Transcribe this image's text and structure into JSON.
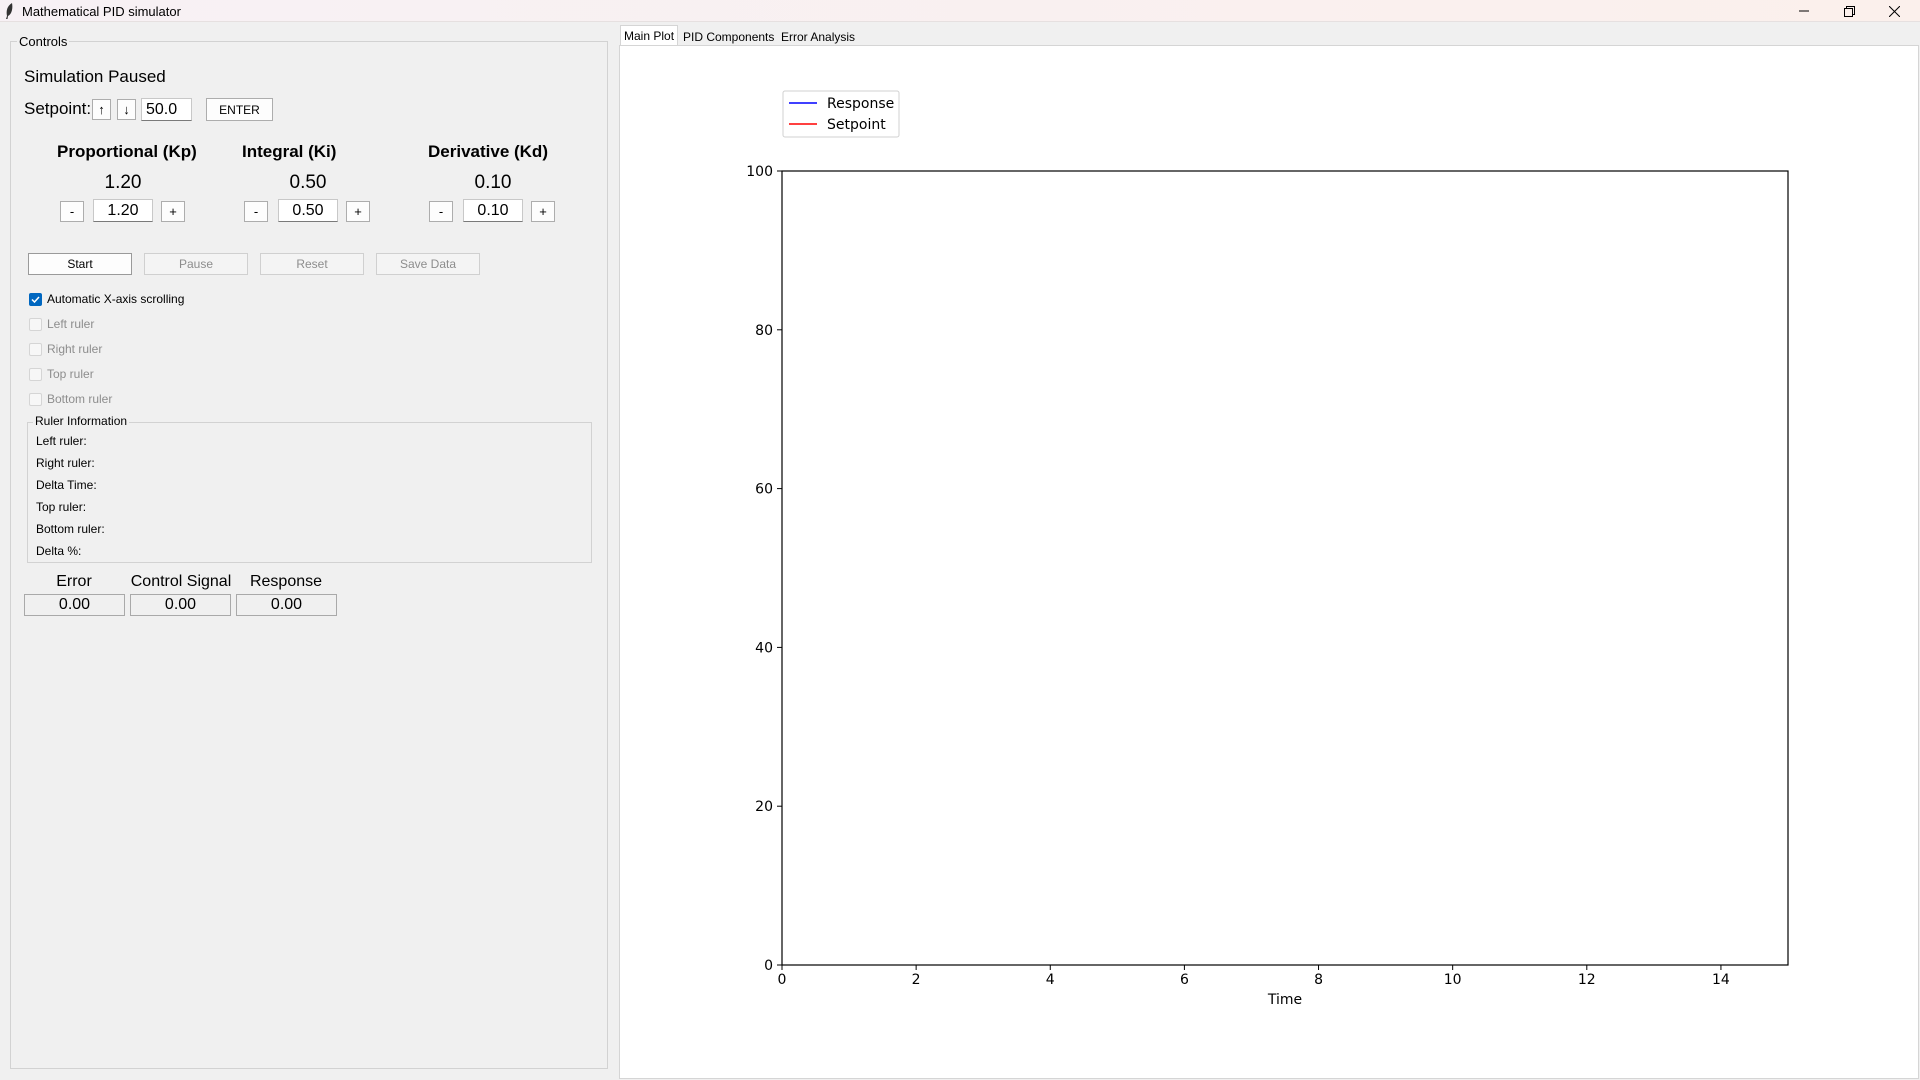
{
  "window": {
    "title": "Mathematical PID simulator"
  },
  "controls": {
    "frame_label": "Controls",
    "status": "Simulation Paused",
    "setpoint": {
      "label": "Setpoint:",
      "up_label": "↑",
      "down_label": "↓",
      "value": "50.0",
      "enter_label": "ENTER"
    },
    "gains": [
      {
        "title": "Proportional (Kp)",
        "display": "1.20",
        "entry": "1.20",
        "minus": "-",
        "plus": "+"
      },
      {
        "title": "Integral (Ki)",
        "display": "0.50",
        "entry": "0.50",
        "minus": "-",
        "plus": "+"
      },
      {
        "title": "Derivative (Kd)",
        "display": "0.10",
        "entry": "0.10",
        "minus": "-",
        "plus": "+"
      }
    ],
    "buttons": {
      "start": "Start",
      "pause": "Pause",
      "reset": "Reset",
      "save": "Save Data"
    },
    "checkboxes": [
      {
        "label": "Automatic X-axis scrolling",
        "checked": true
      },
      {
        "label": "Left ruler",
        "checked": false
      },
      {
        "label": "Right ruler",
        "checked": false
      },
      {
        "label": "Top ruler",
        "checked": false
      },
      {
        "label": "Bottom ruler",
        "checked": false
      }
    ],
    "ruler_info": {
      "title": "Ruler Information",
      "lines": [
        "Left ruler:",
        "Right ruler:",
        "Delta Time:",
        "Top ruler:",
        "Bottom ruler:",
        "Delta %:"
      ]
    },
    "readouts": [
      {
        "label": "Error",
        "value": "0.00"
      },
      {
        "label": "Control Signal",
        "value": "0.00"
      },
      {
        "label": "Response",
        "value": "0.00"
      }
    ]
  },
  "tabs": [
    {
      "label": "Main Plot",
      "active": true
    },
    {
      "label": "PID Components",
      "active": false
    },
    {
      "label": "Error Analysis",
      "active": false
    }
  ],
  "colors": {
    "response": "#0000ff",
    "setpoint": "#ff0000",
    "accent": "#0067c0"
  },
  "chart_data": {
    "type": "line",
    "title": "",
    "xlabel": "Time",
    "ylabel": "",
    "xlim": [
      0,
      15
    ],
    "ylim": [
      0,
      100
    ],
    "xticks": [
      0,
      2,
      4,
      6,
      8,
      10,
      12,
      14
    ],
    "yticks": [
      0,
      20,
      40,
      60,
      80,
      100
    ],
    "grid": false,
    "legend_position": "top-left, outside axes",
    "series": [
      {
        "name": "Response",
        "color": "#0000ff",
        "x": [],
        "y": []
      },
      {
        "name": "Setpoint",
        "color": "#ff0000",
        "x": [],
        "y": []
      }
    ]
  }
}
